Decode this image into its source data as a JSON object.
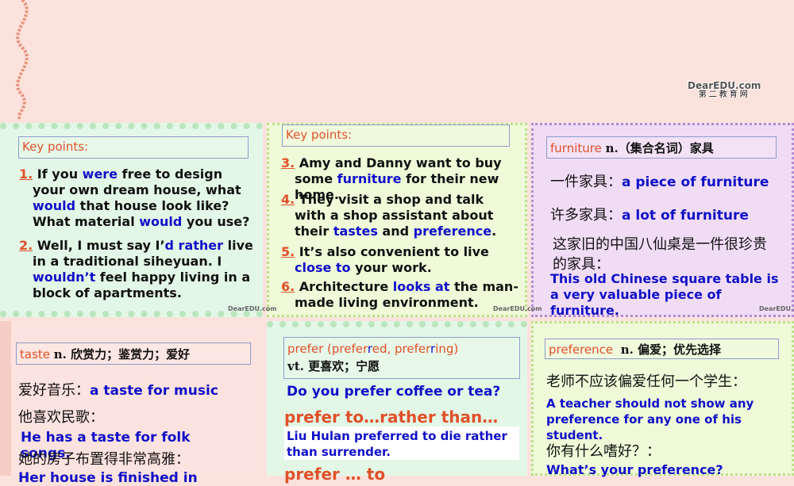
{
  "logo": {
    "text": "DearEDU.com",
    "sub": "第二教育网"
  },
  "panel1": {
    "header": "Key points:",
    "items": [
      {
        "num": "1.",
        "segs": [
          [
            "k",
            "If you "
          ],
          [
            "b",
            "were"
          ],
          [
            "k",
            " free to design your own dream house, what "
          ],
          [
            "b",
            "would"
          ],
          [
            "k",
            " that house look like? What material "
          ],
          [
            "b",
            "would"
          ],
          [
            "k",
            " you use?"
          ]
        ]
      },
      {
        "num": "2.",
        "segs": [
          [
            "k",
            "Well, I must say I’"
          ],
          [
            "b",
            "d rather"
          ],
          [
            "k",
            " live in a traditional siheyuan. I "
          ],
          [
            "b",
            "wouldn’t"
          ],
          [
            "k",
            " feel happy living in a block of apartments."
          ]
        ]
      }
    ]
  },
  "panel2": {
    "header": "Key points:",
    "items": [
      {
        "num": "3.",
        "segs": [
          [
            "k",
            "Amy and Danny want to buy some "
          ],
          [
            "b",
            "furniture"
          ],
          [
            "k",
            " for their new home."
          ]
        ]
      },
      {
        "num": "4.",
        "segs": [
          [
            "k",
            "They visit a shop and talk with a shop assistant about their "
          ],
          [
            "b",
            "tastes"
          ],
          [
            "k",
            " and "
          ],
          [
            "b",
            "preference"
          ],
          [
            "k",
            "."
          ]
        ]
      },
      {
        "num": "5.",
        "segs": [
          [
            "k",
            "It’s also convenient to live "
          ],
          [
            "b",
            "close to"
          ],
          [
            "k",
            " your work."
          ]
        ]
      },
      {
        "num": "6.",
        "segs": [
          [
            "k",
            "Architecture "
          ],
          [
            "b",
            "looks at"
          ],
          [
            "k",
            " the man-made living environment."
          ]
        ]
      }
    ]
  },
  "panel3": {
    "word": "furniture",
    "pos": "n.（集合名词）家具",
    "l1_cn": "一件家具：",
    "l1_en": "a piece of furniture",
    "l2_cn": "许多家具：",
    "l2_en": "a lot of furniture",
    "l3_cn": "这家旧的中国八仙桌是一件很珍贵的家具：",
    "l3_en": "This old Chinese square table is a very valuable piece of furniture."
  },
  "panel4": {
    "word": "taste",
    "pos": "n. 欣赏力；鉴赏力；爱好",
    "l1_cn": "爱好音乐：",
    "l1_en": "a taste for music",
    "l2_cn": "他喜欢民歌：",
    "l2_en": "He has a taste for folk songs.",
    "l3_cn": "她的房子布置得非常高雅：",
    "l3_en": "Her house is finished in"
  },
  "panel5": {
    "word_a": "prefer (prefer",
    "word_r1": "r",
    "word_b": "ed, prefer",
    "word_r2": "r",
    "word_c": "ing)",
    "pos": "vt. 更喜欢；宁愿",
    "ex1": "Do you prefer coffee or tea?",
    "pattern1": "prefer to…rather than…",
    "ex2": "Liu Hulan preferred to die rather than surrender.",
    "pattern2": "prefer … to"
  },
  "panel6": {
    "word": "preference",
    "pos": "n. 偏爱；优先选择",
    "l1_cn": "老师不应该偏爱任何一个学生：",
    "l1_en": "A teacher should not show any preference for any one of his student.",
    "l2_cn": "你有什么嗜好？：",
    "l2_en": "What’s your preference?"
  },
  "watermark": "DearEDU.com"
}
